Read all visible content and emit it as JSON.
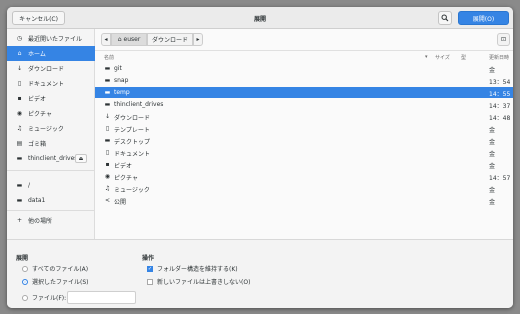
{
  "header": {
    "cancel_label": "キャンセル(C)",
    "title": "展開",
    "open_label": "展開(O)",
    "search_icon": "search-icon"
  },
  "sidebar": {
    "items": [
      {
        "icon": "◷",
        "label": "最近開いたファイル"
      },
      {
        "icon": "⌂",
        "label": "ホーム"
      },
      {
        "icon": "↓",
        "label": "ダウンロード"
      },
      {
        "icon": "▯",
        "label": "ドキュメント"
      },
      {
        "icon": "▪",
        "label": "ビデオ"
      },
      {
        "icon": "◉",
        "label": "ピクチャ"
      },
      {
        "icon": "♫",
        "label": "ミュージック"
      },
      {
        "icon": "▤",
        "label": "ゴミ箱"
      },
      {
        "icon": "▬",
        "label": "thinclient_drives"
      },
      {
        "icon": "▬",
        "label": "/"
      },
      {
        "icon": "▬",
        "label": "data1"
      },
      {
        "icon": "+",
        "label": "他の場所"
      }
    ],
    "selected_index": 1,
    "eject_icon": "⏏"
  },
  "pathbar": {
    "back_glyph": "◂",
    "home_icon": "⌂",
    "crumbs": [
      "euser",
      "ダウンロード"
    ],
    "forward_glyph": "▸",
    "new_folder_glyph": "⊡"
  },
  "columns": {
    "name": "名前",
    "size": "サイズ",
    "type": "型",
    "modified": "更新日時",
    "sort_glyph": "▾"
  },
  "files": [
    {
      "icon": "▬",
      "name": "git",
      "modified": "金"
    },
    {
      "icon": "▬",
      "name": "snap",
      "modified": "13：54"
    },
    {
      "icon": "▬",
      "name": "temp",
      "modified": "14：55"
    },
    {
      "icon": "▬",
      "name": "thinclient_drives",
      "modified": "14：37"
    },
    {
      "icon": "↓",
      "name": "ダウンロード",
      "modified": "14：48"
    },
    {
      "icon": "▯",
      "name": "テンプレート",
      "modified": "金"
    },
    {
      "icon": "▬",
      "name": "デスクトップ",
      "modified": "金"
    },
    {
      "icon": "▯",
      "name": "ドキュメント",
      "modified": "金"
    },
    {
      "icon": "▪",
      "name": "ビデオ",
      "modified": "金"
    },
    {
      "icon": "◉",
      "name": "ピクチャ",
      "modified": "14：57"
    },
    {
      "icon": "♫",
      "name": "ミュージック",
      "modified": "金"
    },
    {
      "icon": "<",
      "name": "公開",
      "modified": "金"
    }
  ],
  "selected_file_index": 2,
  "extract": {
    "label": "展開",
    "options": [
      "すべてのファイル(A)",
      "選択したファイル(S)",
      "ファイル(F):"
    ],
    "selected": 1,
    "file_pattern_value": ""
  },
  "actions": {
    "label": "操作",
    "keep_structure": "フォルダー構造を維持する(K)",
    "keep_structure_checked": true,
    "no_overwrite": "新しいファイルは上書きしない(O)",
    "no_overwrite_checked": false
  },
  "colors": {
    "accent": "#3584e4"
  }
}
